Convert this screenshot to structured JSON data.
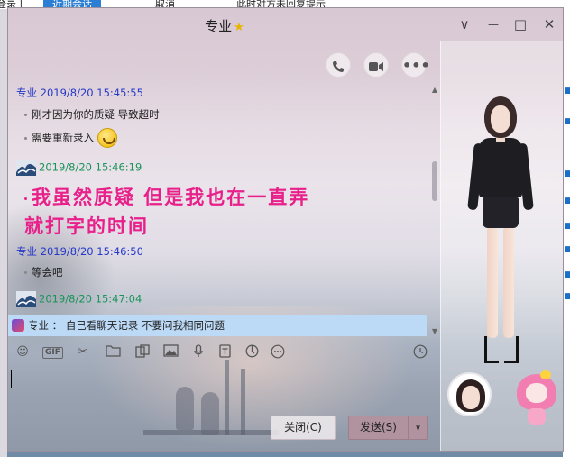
{
  "background_window": {
    "tabs": [
      "登录 |",
      "近期会话",
      "取消",
      "此时对方未回复提示"
    ]
  },
  "window": {
    "title": "专业",
    "title_badge": "star-icon",
    "controls": {
      "chevron": "∨",
      "minimize": "—",
      "maximize": "□",
      "close": "✕"
    }
  },
  "actions": {
    "voice_call": "phone-icon",
    "video_call": "video-icon",
    "more": "more-icon"
  },
  "messages": [
    {
      "sender": "专业",
      "time": "2019/8/20 15:45:55",
      "self": false,
      "lines": [
        "刚才因为你的质疑  导致超时",
        "需要重新录入"
      ]
    },
    {
      "sender": "",
      "time": "2019/8/20 15:46:19",
      "self": true,
      "lines": [
        "我虽然质疑 但是我也在一直弄",
        "就打字的时间"
      ]
    },
    {
      "sender": "专业",
      "time": "2019/8/20 15:46:50",
      "self": false,
      "lines": [
        "等会吧"
      ]
    },
    {
      "sender": "",
      "time": "2019/8/20 15:47:04",
      "self": true,
      "lines": []
    }
  ],
  "notice": {
    "sender": "专业",
    "separator": "：",
    "text": "自己看聊天记录  不要问我相同问题"
  },
  "input_toolbar": {
    "gif_label": "GIF",
    "icons": [
      "emoji-icon",
      "gif-icon",
      "scissors-icon",
      "folder-icon",
      "clipboard-icon",
      "image-icon",
      "mic-icon",
      "document-icon",
      "red-packet-icon",
      "more-icon",
      "history-icon"
    ]
  },
  "buttons": {
    "close_label": "关闭(C)",
    "send_label": "发送(S)",
    "send_dropdown": "∨"
  },
  "colors": {
    "accent_pink": "#e8208a",
    "sender_blue": "#2438c8",
    "self_green": "#19945a",
    "notice_bg": "#bcd9f6",
    "send_button": "#b0939e"
  }
}
